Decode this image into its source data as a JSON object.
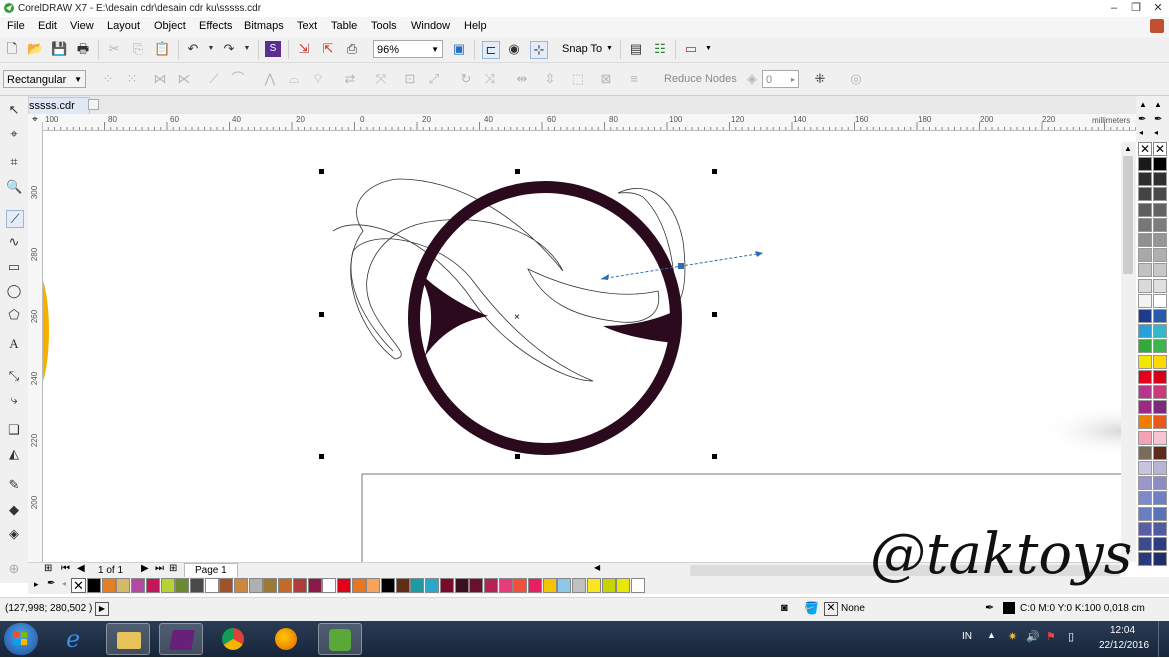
{
  "window": {
    "title": "CorelDRAW X7 - E:\\desain cdr\\desain cdr ku\\sssss.cdr"
  },
  "menu": [
    "File",
    "Edit",
    "View",
    "Layout",
    "Object",
    "Effects",
    "Bitmaps",
    "Text",
    "Table",
    "Tools",
    "Window",
    "Help"
  ],
  "toolbar1": {
    "zoom": "96%",
    "snap_to": "Snap To"
  },
  "toolbar2": {
    "node_mode": "Rectangular",
    "reduce_nodes": "Reduce Nodes",
    "smoothness": "0"
  },
  "document": {
    "tab": "sssss.cdr",
    "ruler_unit": "millimeters"
  },
  "hruler_ticks": [
    "100",
    "80",
    "60",
    "40",
    "20",
    "0",
    "20",
    "40",
    "60",
    "80",
    "100",
    "120",
    "140",
    "160",
    "180",
    "200",
    "220"
  ],
  "vruler_ticks": [
    "300",
    "280",
    "260",
    "240",
    "220",
    "200"
  ],
  "pagenav": {
    "count": "1 of 1",
    "page_tab": "Page 1"
  },
  "palette_bottom": [
    "#000000",
    "#e67e22",
    "#d4b96a",
    "#b24aa0",
    "#c2185b",
    "#b5d335",
    "#6d8a2f",
    "#4a4a4a",
    "#ffffff",
    "#a0522d",
    "#cd853f",
    "#b0b0b0",
    "#9b7a33",
    "#c46a28",
    "#b03c3c",
    "#8b1a4a",
    "#ffffff",
    "#e0001b",
    "#e87722",
    "#f7a35c",
    "#000000",
    "#5e2e17",
    "#1a9ba6",
    "#2aa7c9",
    "#7a0a2a",
    "#3b0f1f",
    "#6a1030",
    "#b42354",
    "#e63c7c",
    "#f0503c",
    "#e81e63",
    "#f4c400",
    "#8fc7e6",
    "#c0c0c0",
    "#f8e71c",
    "#c8d400",
    "#e8e800",
    "#ffffff"
  ],
  "palette_right": [
    [
      "#1a1a1a",
      "#000000"
    ],
    [
      "#2e2e2e",
      "#303030"
    ],
    [
      "#444444",
      "#4a4a4a"
    ],
    [
      "#5e5e5e",
      "#636363"
    ],
    [
      "#777777",
      "#7d7d7d"
    ],
    [
      "#909090",
      "#969696"
    ],
    [
      "#a8a8a8",
      "#b0b0b0"
    ],
    [
      "#c2c2c2",
      "#c8c8c8"
    ],
    [
      "#dadada",
      "#e0e0e0"
    ],
    [
      "#f2f2f2",
      "#ffffff"
    ],
    [
      "#1f3b8c",
      "#2a5ba8"
    ],
    [
      "#29a0d8",
      "#36b7c9"
    ],
    [
      "#33a83c",
      "#3cb54a"
    ],
    [
      "#f2e500",
      "#ffd800"
    ],
    [
      "#e2001a",
      "#d4001a"
    ],
    [
      "#b5368c",
      "#c93a7a"
    ],
    [
      "#9c2a85",
      "#7d2a7c"
    ],
    [
      "#f07c00",
      "#e8581a"
    ],
    [
      "#f4a2b4",
      "#f7c4cf"
    ],
    [
      "#7a6b5a",
      "#5e2a1a"
    ],
    [
      "#c8c4e0",
      "#b6b4d8"
    ],
    [
      "#9b97cc",
      "#8e8ac4"
    ],
    [
      "#7f8acb",
      "#7080c4"
    ],
    [
      "#6c7ec2",
      "#5a72b8"
    ],
    [
      "#5b5ea6",
      "#505aa0"
    ],
    [
      "#3e4a8c",
      "#2c3e80"
    ],
    [
      "#2a3a7a",
      "#1f2e6a"
    ]
  ],
  "status": {
    "coords": "(127,998; 280,502 )",
    "fill": "None",
    "outline": "C:0 M:0 Y:0 K:100  0,018 cm"
  },
  "watermark": "@taktoys",
  "taskbar": {
    "language": "IN",
    "time": "12:04",
    "date": "22/12/2016"
  }
}
